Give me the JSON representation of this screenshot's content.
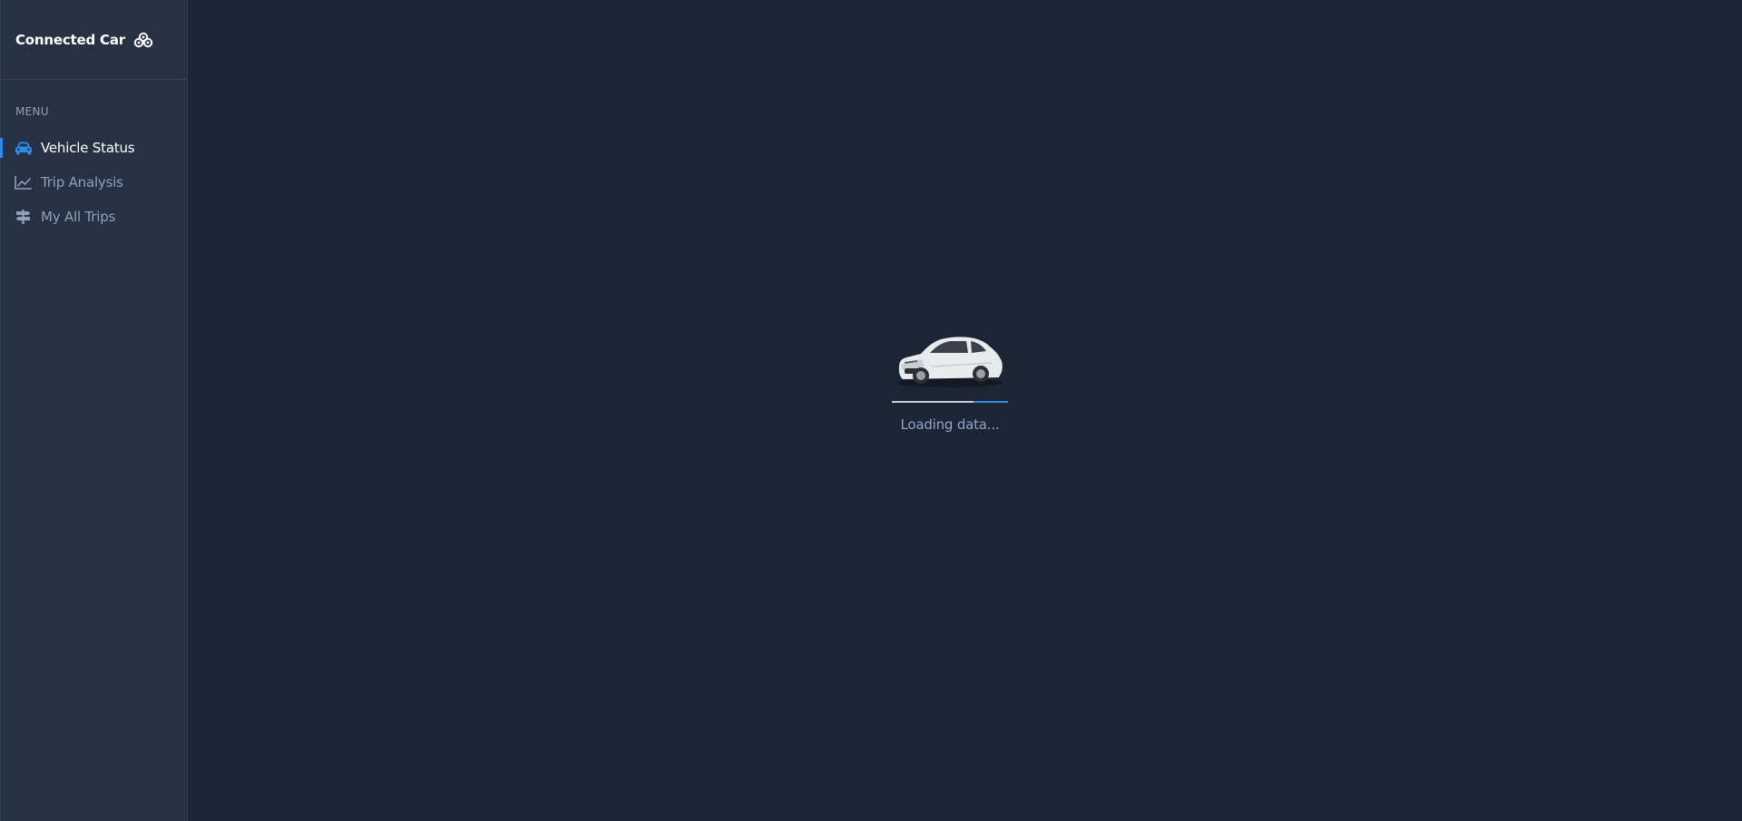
{
  "app": {
    "title": "Connected Car",
    "brand_icon": "cloud-network-icon"
  },
  "sidebar": {
    "menu_heading": "MENU",
    "items": [
      {
        "label": "Vehicle Status",
        "icon": "car-icon",
        "active": true
      },
      {
        "label": "Trip Analysis",
        "icon": "line-chart-icon",
        "active": false
      },
      {
        "label": "My All Trips",
        "icon": "signpost-icon",
        "active": false
      }
    ]
  },
  "main": {
    "loader": {
      "image": "car-image",
      "text": "Loading data...",
      "progress": 0.3
    }
  },
  "colors": {
    "background": "#1c2533",
    "sidebar": "#263244",
    "accent": "#2d8ce8",
    "muted_text": "#8f9fbd",
    "active_text": "#ffffff"
  }
}
